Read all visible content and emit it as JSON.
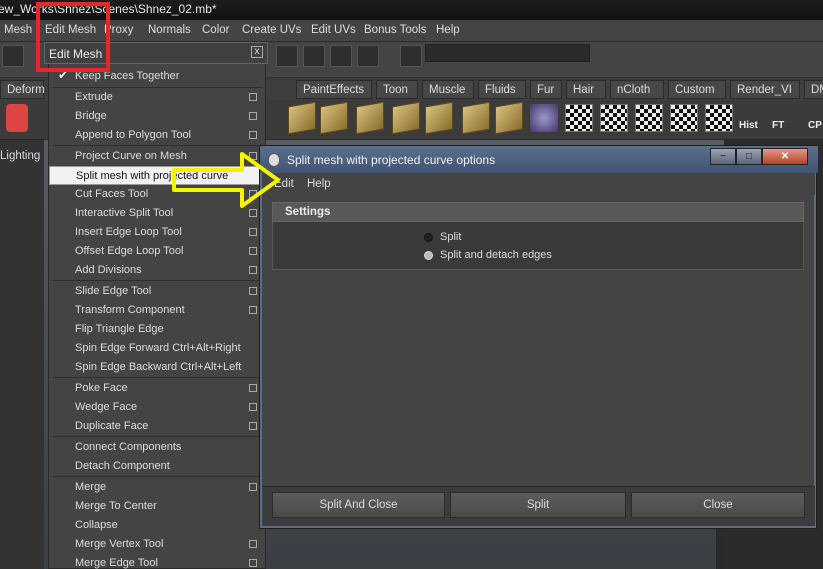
{
  "window": {
    "title": "ew_Works\\Shnez\\Scenes\\Shnez_02.mb*"
  },
  "menubar": [
    "Mesh",
    "Edit Mesh",
    "Proxy",
    "Normals",
    "Color",
    "Create UVs",
    "Edit UVs",
    "Bonus Tools",
    "Help"
  ],
  "shelf_tabs": [
    "Deform",
    "PaintEffects",
    "Toon",
    "Muscle",
    "Fluids",
    "Fur",
    "Hair",
    "nCloth",
    "Custom",
    "Render_VI",
    "DM"
  ],
  "shelf_icon_labels": {
    "hist": "Hist",
    "ft": "FT",
    "cp": "CP"
  },
  "left_panel": {
    "label": "Lighting"
  },
  "edit_mesh_menu": {
    "title": "Edit Mesh",
    "close": "x",
    "items": [
      {
        "label": "Keep Faces Together",
        "checked": "✔"
      },
      {
        "label": "Extrude"
      },
      {
        "label": "Bridge"
      },
      {
        "label": "Append to Polygon Tool"
      },
      {
        "label": "Project Curve on Mesh"
      },
      {
        "label": "Split mesh with projected curve"
      },
      {
        "label": "Cut Faces Tool"
      },
      {
        "label": "Interactive Split Tool"
      },
      {
        "label": "Insert Edge Loop Tool"
      },
      {
        "label": "Offset Edge Loop Tool"
      },
      {
        "label": "Add Divisions"
      },
      {
        "label": "Slide Edge Tool"
      },
      {
        "label": "Transform Component"
      },
      {
        "label": "Flip Triangle Edge"
      },
      {
        "label": "Spin Edge Forward",
        "shortcut": "Ctrl+Alt+Right"
      },
      {
        "label": "Spin Edge Backward",
        "shortcut": "Ctrl+Alt+Left"
      },
      {
        "label": "Poke Face"
      },
      {
        "label": "Wedge Face"
      },
      {
        "label": "Duplicate Face"
      },
      {
        "label": "Connect Components"
      },
      {
        "label": "Detach Component"
      },
      {
        "label": "Merge"
      },
      {
        "label": "Merge To Center"
      },
      {
        "label": "Collapse"
      },
      {
        "label": "Merge Vertex Tool"
      },
      {
        "label": "Merge Edge Tool"
      }
    ]
  },
  "dialog": {
    "title": "Split mesh with projected curve options",
    "window_buttons": {
      "minimize": "−",
      "maximize": "□",
      "close": "✕"
    },
    "menu": [
      "Edit",
      "Help"
    ],
    "section": "Settings",
    "options": [
      {
        "label": "Split",
        "selected": false
      },
      {
        "label": "Split and detach edges",
        "selected": true
      }
    ],
    "buttons": [
      "Split And Close",
      "Split",
      "Close"
    ]
  },
  "colors": {
    "highlight_box": "#e8262a",
    "arrow": "#f4f400",
    "dialog_caption": "#4d6280"
  }
}
